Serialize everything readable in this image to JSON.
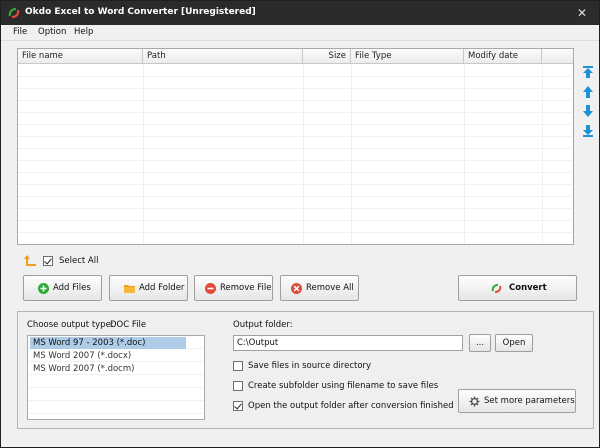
{
  "window": {
    "title": "Okdo Excel to Word Converter [Unregistered]",
    "close_glyph": "✕"
  },
  "menu": [
    "File",
    "Option",
    "Help"
  ],
  "table": {
    "columns": [
      "File name",
      "Path",
      "Size",
      "File Type",
      "Modify date"
    ]
  },
  "select_all": {
    "label": "Select All",
    "checked": true
  },
  "buttons": {
    "add_files": "Add Files",
    "add_folder": "Add Folder",
    "remove_file": "Remove File",
    "remove_all": "Remove All",
    "convert": "Convert"
  },
  "output": {
    "type_label": "Choose output type:",
    "type_value": "DOC File",
    "formats": [
      "MS Word 97 - 2003 (*.doc)",
      "MS Word 2007 (*.docx)",
      "MS Word 2007 (*.docm)"
    ],
    "selected_format_index": 0,
    "folder_label": "Output folder:",
    "folder_value": "C:\\Output",
    "browse_label": "...",
    "open_label": "Open",
    "options": [
      {
        "label": "Save files in source directory",
        "checked": false
      },
      {
        "label": "Create subfolder using filename to save files",
        "checked": false
      },
      {
        "label": "Open the output folder after conversion finished",
        "checked": true
      }
    ],
    "more_params_label": "Set more parameters"
  },
  "icons": {
    "app": "converter-logo-icon",
    "move_top": "move-top-icon",
    "move_up": "move-up-icon",
    "move_down": "move-down-icon",
    "move_bottom": "move-bottom-icon",
    "up_folder": "up-folder-icon",
    "add_files": "plus-circle-icon",
    "add_folder": "folder-icon",
    "remove_file": "minus-circle-icon",
    "remove_all": "x-circle-icon",
    "convert": "convert-icon",
    "gear": "gear-icon"
  },
  "colors": {
    "titlebar": "#2b2b2b",
    "selection": "#aecbe8",
    "accent_blue": "#1e90d8",
    "green": "#2eaa3a",
    "red": "#e04b3a",
    "orange": "#f0a020"
  }
}
